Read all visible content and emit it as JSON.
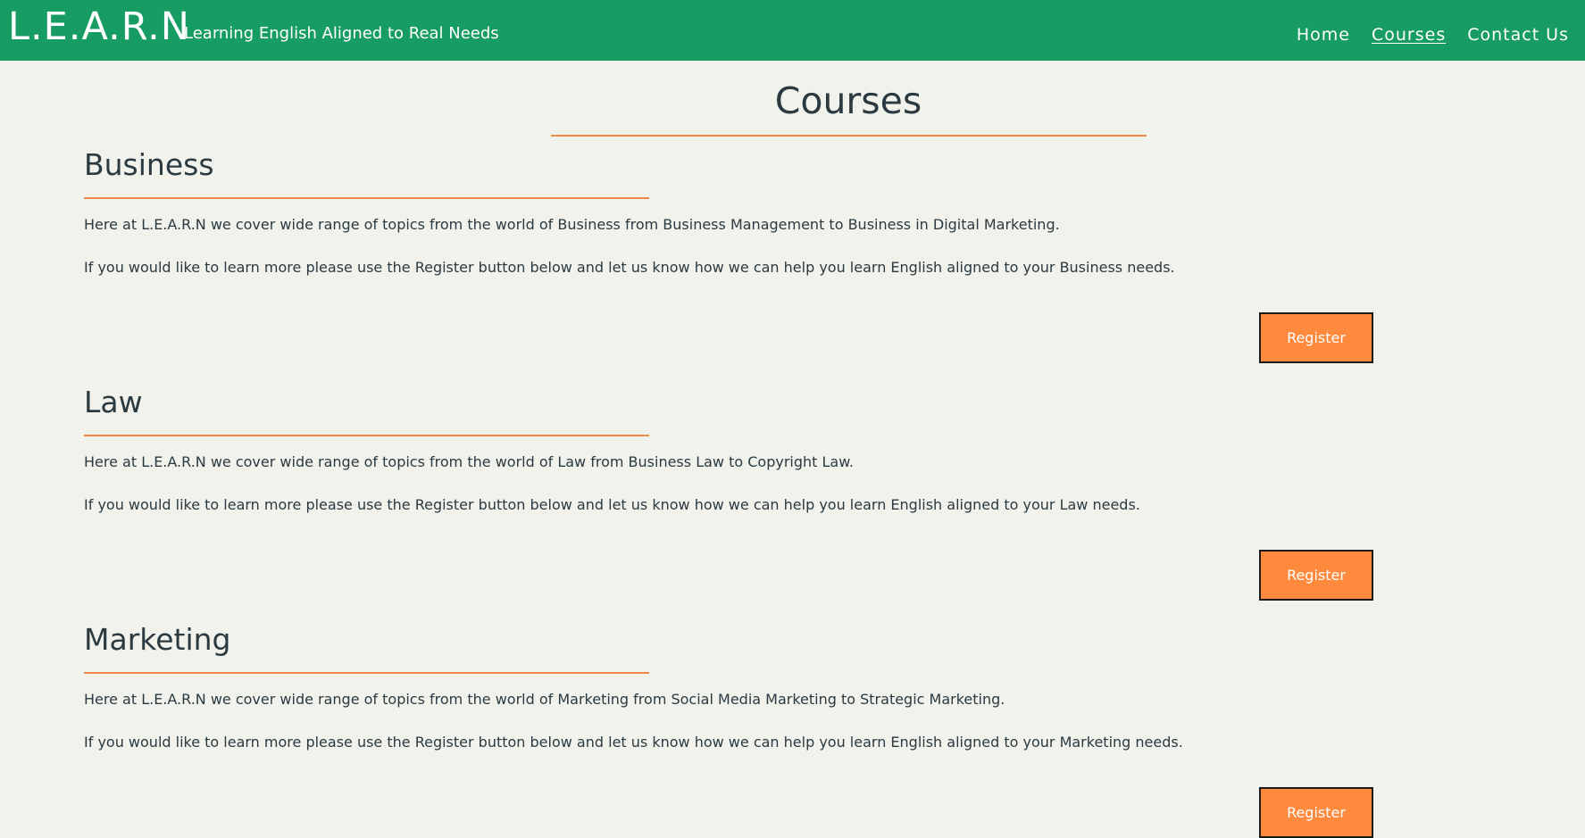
{
  "header": {
    "logo": "L.E.A.R.N",
    "tagline": "Learning English Aligned to Real Needs",
    "nav": [
      {
        "label": "Home"
      },
      {
        "label": "Courses"
      },
      {
        "label": "Contact Us"
      }
    ]
  },
  "colors": {
    "header_bg": "#179c63",
    "page_bg": "#f2f2ed",
    "accent": "#f08a4a",
    "button_bg": "#ff8a3d",
    "text": "#2a3a40"
  },
  "page_title": "Courses",
  "sections": [
    {
      "heading": "Business",
      "p1": "Here at L.E.A.R.N we cover wide range of topics from the world of Business from Business Management to Business in Digital Marketing.",
      "p2": "If you would like to learn more please use the Register button below and let us know how we can help you learn English aligned to your Business needs.",
      "button": "Register"
    },
    {
      "heading": "Law",
      "p1": "Here at L.E.A.R.N we cover wide range of topics from the world of Law from Business Law to Copyright Law.",
      "p2": "If you would like to learn more please use the Register button below and let us know how we can help you learn English aligned to your Law needs.",
      "button": "Register"
    },
    {
      "heading": "Marketing",
      "p1": "Here at L.E.A.R.N we cover wide range of topics from the world of Marketing from Social Media Marketing to Strategic Marketing.",
      "p2": "If you would like to learn more please use the Register button below and let us know how we can help you learn English aligned to your Marketing needs.",
      "button": "Register"
    }
  ]
}
